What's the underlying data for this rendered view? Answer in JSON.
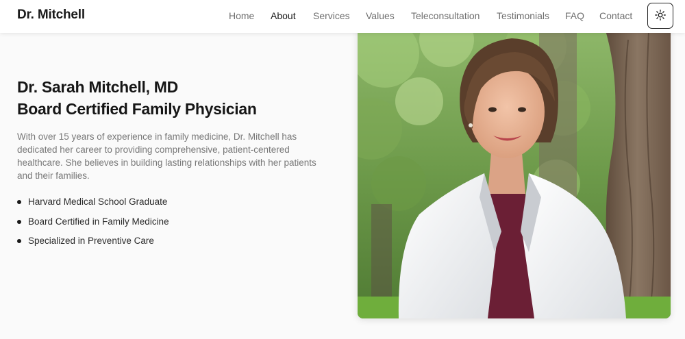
{
  "header": {
    "brand": "Dr. Mitchell",
    "nav": [
      {
        "label": "Home",
        "name": "nav-home",
        "active": false
      },
      {
        "label": "About",
        "name": "nav-about",
        "active": true
      },
      {
        "label": "Services",
        "name": "nav-services",
        "active": false
      },
      {
        "label": "Values",
        "name": "nav-values",
        "active": false
      },
      {
        "label": "Teleconsultation",
        "name": "nav-teleconsultation",
        "active": false
      },
      {
        "label": "Testimonials",
        "name": "nav-testimonials",
        "active": false
      },
      {
        "label": "FAQ",
        "name": "nav-faq",
        "active": false
      },
      {
        "label": "Contact",
        "name": "nav-contact",
        "active": false
      }
    ],
    "theme_toggle_icon": "sun-icon"
  },
  "hero": {
    "title_line1": "Dr. Sarah Mitchell, MD",
    "title_line2": "Board Certified Family Physician",
    "description": "With over 15 years of experience in family medicine, Dr. Mitchell has dedicated her career to providing comprehensive, patient-centered healthcare. She believes in building lasting relationships with her patients and their families.",
    "credentials": [
      "Harvard Medical School Graduate",
      "Board Certified in Family Medicine",
      "Specialized in Preventive Care"
    ]
  },
  "portrait": {
    "icon": "doctor-portrait-photo"
  },
  "colors": {
    "background": "#fafafa",
    "navbar": "#ffffff",
    "text_primary": "#161616",
    "text_muted": "#777777",
    "nav_inactive": "#6e6e6e"
  }
}
